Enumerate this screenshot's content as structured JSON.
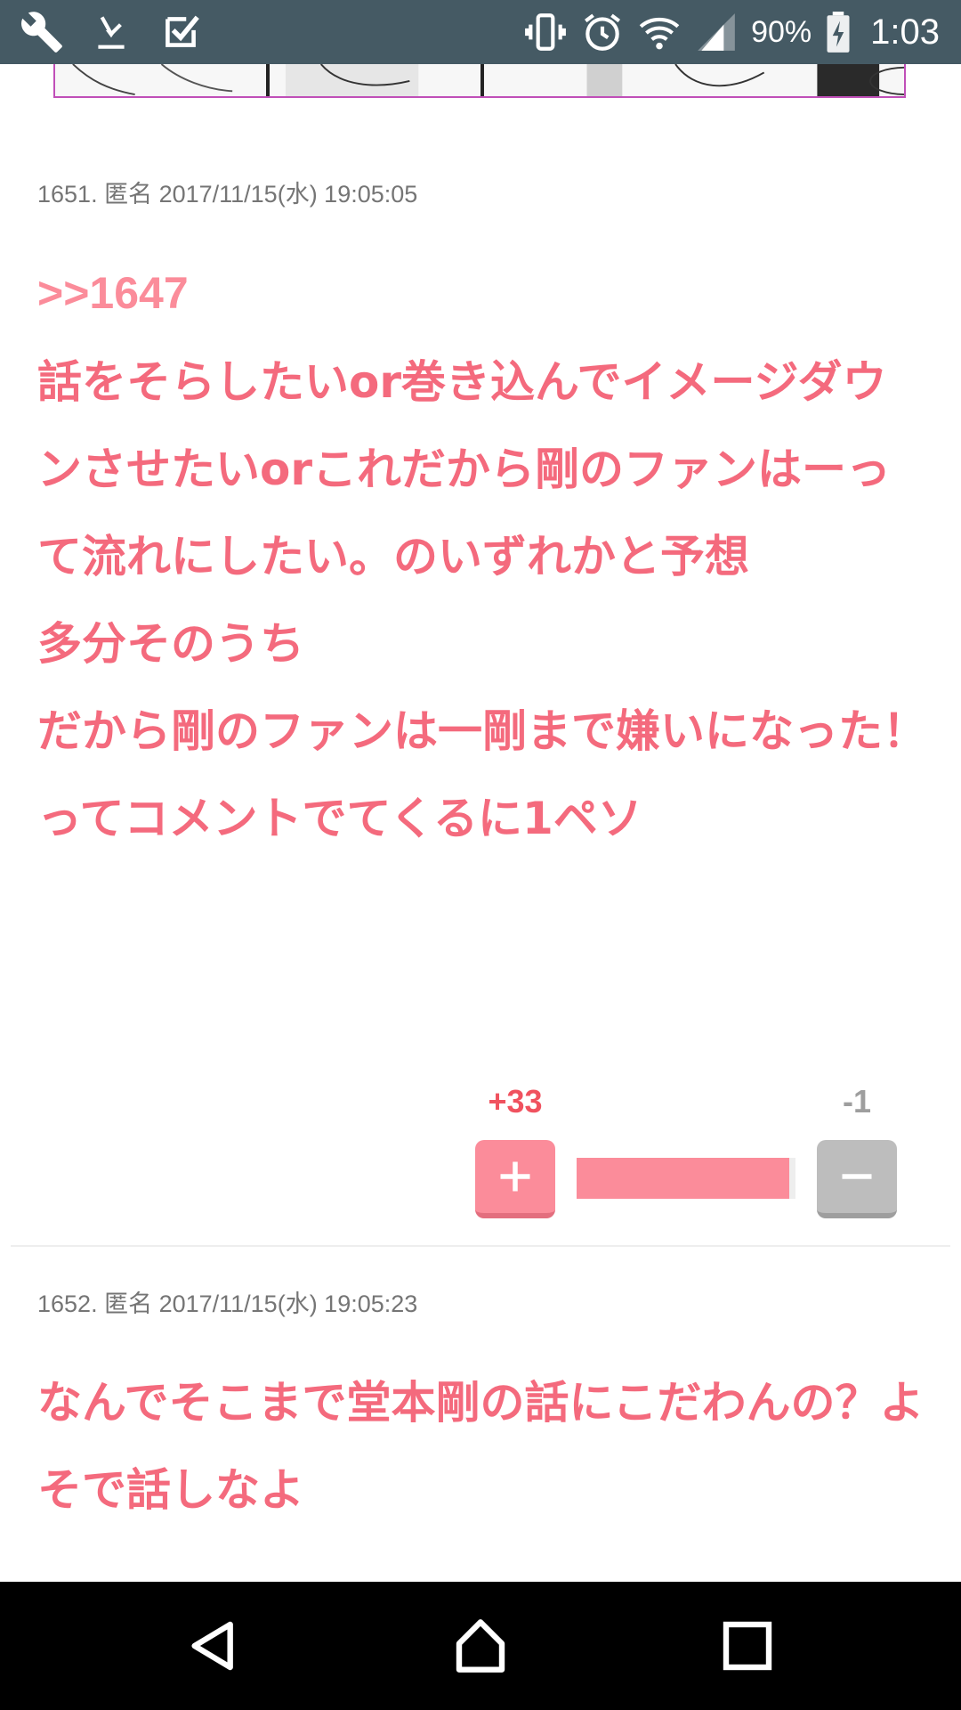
{
  "status_bar": {
    "battery_percent": "90%",
    "time": "1:03",
    "left_icons": [
      "wrench-icon",
      "download-done-icon",
      "checkbox-icon"
    ],
    "right_icons": [
      "vibrate-icon",
      "alarm-icon",
      "wifi-icon",
      "signal-icon",
      "battery-charging-icon"
    ]
  },
  "comments": [
    {
      "meta": "1651. 匿名 2017/11/15(水) 19:05:05",
      "reply_to": ">>1647",
      "body": "話をそらしたいor巻き込んでイメージダウンさせたいorこれだから剛のファンはーって流れにしたい。のいずれかと予想\n多分そのうち\nだから剛のファンは一剛まで嫌いになった！ってコメントでてくるに1ペソ",
      "votes": {
        "plus": "+33",
        "minus": "-1",
        "plus_ratio": 0.97
      }
    },
    {
      "meta": "1652. 匿名 2017/11/15(水) 19:05:23",
      "body": "なんでそこまで堂本剛の話にこだわんの？よそで話しなよ"
    }
  ],
  "colors": {
    "status_bar": "#455a64",
    "comment_text": "#f46a7d",
    "reply_anchor": "#fb8c9a",
    "plus_count": "#f0525f",
    "minus_button": "#bdbdbd"
  }
}
